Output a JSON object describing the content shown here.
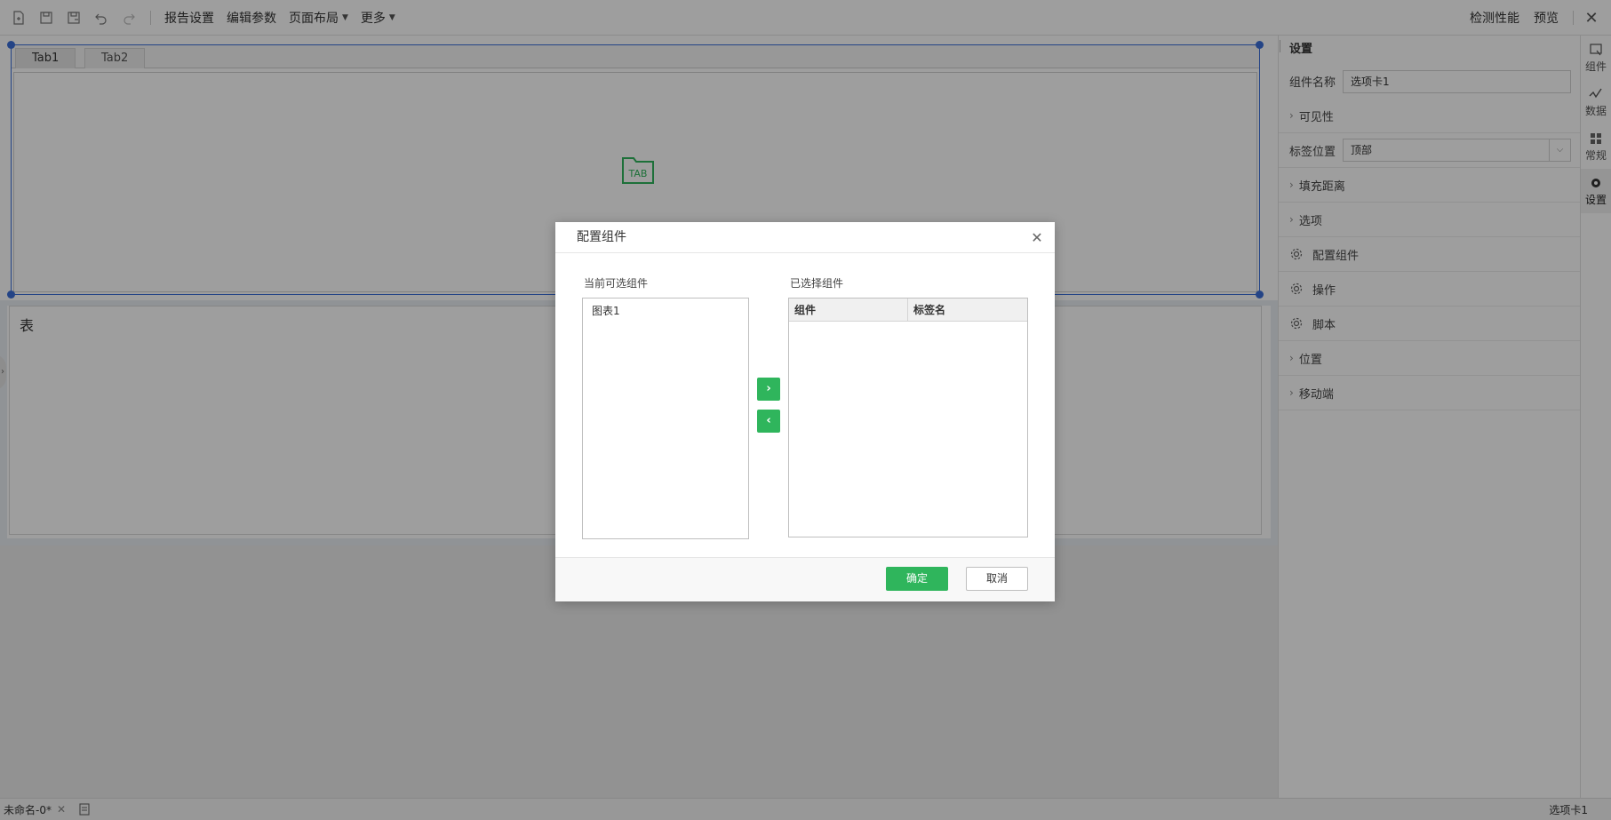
{
  "toolbar": {
    "report_settings": "报告设置",
    "edit_params": "编辑参数",
    "page_layout": "页面布局",
    "more": "更多",
    "check_performance": "检测性能",
    "preview": "预览"
  },
  "canvas": {
    "tabs": [
      {
        "label": "Tab1"
      },
      {
        "label": "Tab2"
      }
    ],
    "tab_logo_text": "TAB",
    "table_title": "表"
  },
  "panel": {
    "title": "设置",
    "component_name_label": "组件名称",
    "component_name_value": "选项卡1",
    "visibility": "可见性",
    "tab_position_label": "标签位置",
    "tab_position_value": "顶部",
    "padding": "填充距离",
    "options": "选项",
    "configure_components": "配置组件",
    "actions": "操作",
    "script": "脚本",
    "position": "位置",
    "mobile": "移动端"
  },
  "rail": {
    "items": [
      {
        "label": "组件",
        "icon": "component-icon"
      },
      {
        "label": "数据",
        "icon": "data-icon"
      },
      {
        "label": "常规",
        "icon": "general-icon"
      },
      {
        "label": "设置",
        "icon": "gear-icon"
      }
    ],
    "active": "设置"
  },
  "statusbar": {
    "file_name": "未命名-0*",
    "selected_component": "选项卡1"
  },
  "dialog": {
    "title": "配置组件",
    "available_label": "当前可选组件",
    "available_items": [
      {
        "label": "图表1"
      }
    ],
    "selected_label": "已选择组件",
    "selected_columns": [
      "组件",
      "标签名"
    ],
    "move_right": "›",
    "move_left": "‹",
    "ok": "确定",
    "cancel": "取消"
  }
}
